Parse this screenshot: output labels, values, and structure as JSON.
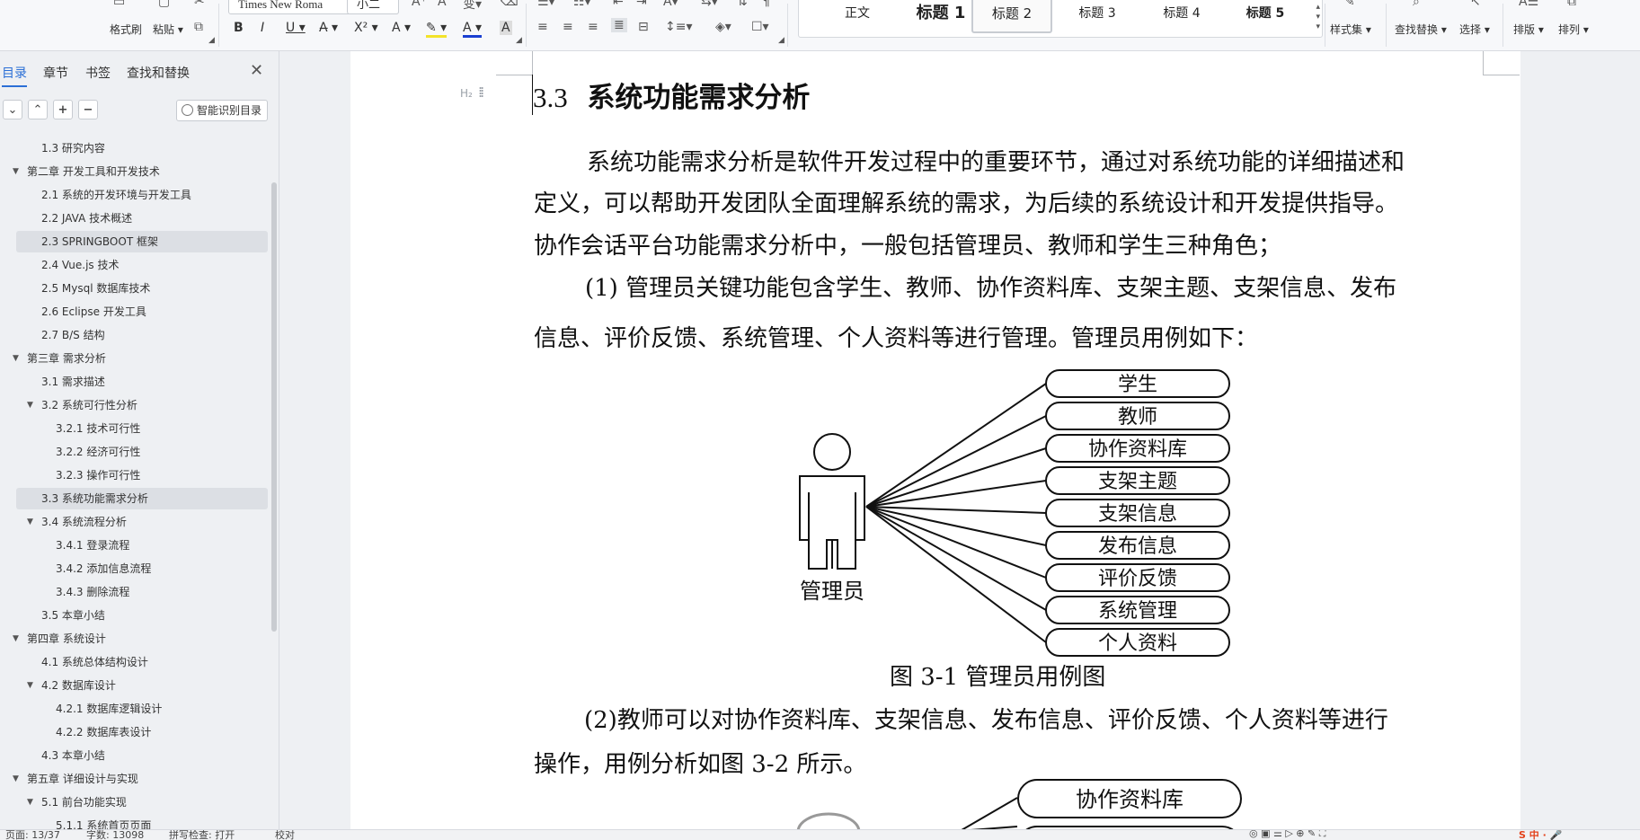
{
  "ribbon": {
    "format_painter": "格式刷",
    "paste": "粘贴",
    "font_name": "Times New Roma",
    "font_size": "小二",
    "style_gallery": [
      "正文",
      "标题 1",
      "标题 2",
      "标题 3",
      "标题 4",
      "标题 5"
    ],
    "style_gallery_active": "标题 2",
    "style_set": "样式集",
    "find_replace": "查找替换",
    "select": "选择",
    "layout": "排版",
    "arrange": "排列"
  },
  "sidebar": {
    "tabs": [
      "目录",
      "章节",
      "书签",
      "查找和替换"
    ],
    "active_tab": "目录",
    "smart_toc": "智能识别目录",
    "toc": [
      {
        "label": "1.3  研究内容",
        "level": 2
      },
      {
        "label": "第二章  开发工具和开发技术",
        "level": 1
      },
      {
        "label": "2.1 系统的开发环境与开发工具",
        "level": 2
      },
      {
        "label": "2.2 JAVA 技术概述",
        "level": 2
      },
      {
        "label": "2.3 SPRINGBOOT  框架",
        "level": 2,
        "selected": true
      },
      {
        "label": "2.4 Vue.js 技术",
        "level": 2
      },
      {
        "label": "2.5 Mysql 数据库技术",
        "level": 2
      },
      {
        "label": "2.6 Eclipse 开发工具",
        "level": 2
      },
      {
        "label": "2.7 B/S 结构",
        "level": 2
      },
      {
        "label": "第三章  需求分析",
        "level": 1
      },
      {
        "label": "3.1  需求描述",
        "level": 2
      },
      {
        "label": "3.2  系统可行性分析",
        "level": 2,
        "expanded": true
      },
      {
        "label": "3.2.1 技术可行性",
        "level": 3
      },
      {
        "label": "3.2.2  经济可行性",
        "level": 3
      },
      {
        "label": "3.2.3  操作可行性",
        "level": 3
      },
      {
        "label": "3.3  系统功能需求分析",
        "level": 2,
        "selected": true
      },
      {
        "label": "3.4  系统流程分析",
        "level": 2,
        "expanded": true
      },
      {
        "label": "3.4.1  登录流程",
        "level": 3
      },
      {
        "label": "3.4.2  添加信息流程",
        "level": 3
      },
      {
        "label": "3.4.3  删除流程",
        "level": 3
      },
      {
        "label": "3.5  本章小结",
        "level": 2
      },
      {
        "label": "第四章  系统设计",
        "level": 1
      },
      {
        "label": "4.1  系统总体结构设计",
        "level": 2
      },
      {
        "label": "4.2  数据库设计",
        "level": 2,
        "expanded": true
      },
      {
        "label": "4.2.1  数据库逻辑设计",
        "level": 3
      },
      {
        "label": "4.2.2  数据库表设计",
        "level": 3
      },
      {
        "label": "4.3  本章小结",
        "level": 2
      },
      {
        "label": "第五章  详细设计与实现",
        "level": 1
      },
      {
        "label": "5.1 前台功能实现",
        "level": 2,
        "expanded": true
      },
      {
        "label": "5.1.1 系统首页页面",
        "level": 3
      }
    ]
  },
  "document": {
    "heading_number": "3.3",
    "heading_text": "系统功能需求分析",
    "para1_line1": "系统功能需求分析是软件开发过程中的重要环节，通过对系统功能的详细描述和",
    "para1_line2": "定义，可以帮助开发团队全面理解系统的需求，为后续的系统设计和开发提供指导。",
    "para1_line3": "协作会话平台功能需求分析中，一般包括管理员、教师和学生三种角色；",
    "para2_line1": "(1)  管理员关键功能包含学生、教师、协作资料库、支架主题、支架信息、发布",
    "para2_line2": "信息、评价反馈、系统管理、个人资料等进行管理。管理员用例如下：",
    "figure1": {
      "actor": "管理员",
      "use_cases": [
        "学生",
        "教师",
        "协作资料库",
        "支架主题",
        "支架信息",
        "发布信息",
        "评价反馈",
        "系统管理",
        "个人资料"
      ],
      "caption": "图 3-1  管理员用例图"
    },
    "para3_line1": "(2)教师可以对协作资料库、支架信息、发布信息、评价反馈、个人资料等进行",
    "para3_line2": "操作，用例分析如图 3-2 所示。",
    "figure2_first_use_case": "协作资料库"
  },
  "status": {
    "page": "页面: 13/37",
    "words": "字数: 13098",
    "spell": "拼写检查: 打开",
    "proof": "校对"
  }
}
